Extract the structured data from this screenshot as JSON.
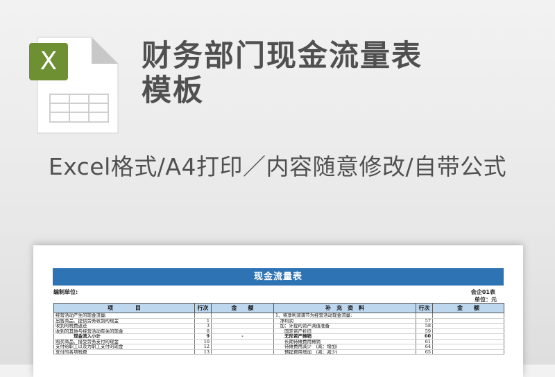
{
  "hero": {
    "title_line1": "财务部门现金流量表",
    "title_line2": "模板",
    "subtitle": "Excel格式/A4打印／内容随意修改/自带公式",
    "icon_letter": "X"
  },
  "colors": {
    "excel_green": "#6f8f33",
    "title_blue": "#2e74b5",
    "header_blue": "#bdd7ee",
    "text_gray": "#505050"
  },
  "sheet": {
    "title": "现金流量表",
    "unit_label": "编制单位:",
    "form_code": "会企01表",
    "currency_unit": "单位：元",
    "headers": [
      "项　　　　目",
      "行次",
      "金　　额",
      "补　充　资　料",
      "行次",
      "金　　额"
    ],
    "rows": [
      {
        "item": "经营活动产生的现金流量:",
        "line": "",
        "amt": "",
        "sup": "1、将净利润调节为经营活动现金流量:",
        "sline": "",
        "samt": "",
        "bold": false
      },
      {
        "item": "出售商品、提供劳务收到的现金",
        "line": "1",
        "amt": "",
        "sup": "　净利润",
        "sline": "57",
        "samt": "",
        "bold": false
      },
      {
        "item": "收到的税费返还",
        "line": "3",
        "amt": "",
        "sup": "　加：计提的资产减值准备",
        "sline": "58",
        "samt": "",
        "bold": false
      },
      {
        "item": "收到的其他与经营活动有关的现金",
        "line": "8",
        "amt": "",
        "sup": "　　固定资产折旧",
        "sline": "59",
        "samt": "",
        "bold": false
      },
      {
        "item": "　　　　现金流入小计",
        "line": "9",
        "amt": "-",
        "sup": "　　无形资产摊销",
        "sline": "60",
        "samt": "",
        "bold": true
      },
      {
        "item": "购买商品、接受劳务支付的现金",
        "line": "10",
        "amt": "",
        "sup": "　　长期待摊费用摊销",
        "sline": "61",
        "samt": "",
        "bold": false
      },
      {
        "item": "支付给职工以及为职工支付的现金",
        "line": "12",
        "amt": "",
        "sup": "　　待摊费用减少　(减：增加)",
        "sline": "64",
        "samt": "",
        "bold": false
      },
      {
        "item": "支付的各项税费",
        "line": "13",
        "amt": "",
        "sup": "　　预提费用增加　(减：减少)",
        "sline": "65",
        "samt": "",
        "bold": false
      }
    ]
  }
}
